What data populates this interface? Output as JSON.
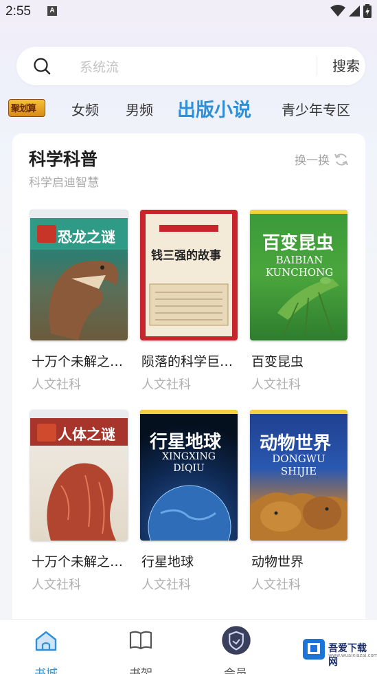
{
  "status": {
    "time": "2:55",
    "indicator": "A"
  },
  "search": {
    "placeholder": "系统流",
    "button": "搜索"
  },
  "tabs": [
    {
      "label": "女频"
    },
    {
      "label": "男频"
    },
    {
      "label": "出版小说",
      "active": true
    },
    {
      "label": "青少年专区"
    }
  ],
  "section": {
    "title": "科学科普",
    "subtitle": "科学启迪智慧",
    "refresh_label": "换一换"
  },
  "books": [
    {
      "title": "十万个未解之谜·恐龙之谜",
      "author": "人文社科",
      "cover_title": "恐龙之谜"
    },
    {
      "title": "陨落的科学巨星：钱三强的故事",
      "author": "人文社科",
      "cover_title": "钱三强的故事"
    },
    {
      "title": "百变昆虫",
      "author": "人文社科",
      "cover_title": "百变昆虫",
      "cover_subtitle": "BAIBIAN KUNCHONG"
    },
    {
      "title": "十万个未解之谜·人体之谜",
      "author": "人文社科",
      "cover_title": "人体之谜"
    },
    {
      "title": "行星地球",
      "author": "人文社科",
      "cover_title": "行星地球",
      "cover_subtitle": "XINGXING DIQIU"
    },
    {
      "title": "动物世界",
      "author": "人文社科",
      "cover_title": "动物世界",
      "cover_subtitle": "DONGWU SHIJIE"
    }
  ],
  "nav": [
    {
      "label": "书城",
      "active": true
    },
    {
      "label": "书架"
    },
    {
      "label": "会员"
    }
  ],
  "watermark": {
    "text": "吾爱下载网",
    "sub": "www.wuaixiazai.com"
  },
  "colors": {
    "accent": "#2f8fd8",
    "muted": "#b0b0b0"
  }
}
